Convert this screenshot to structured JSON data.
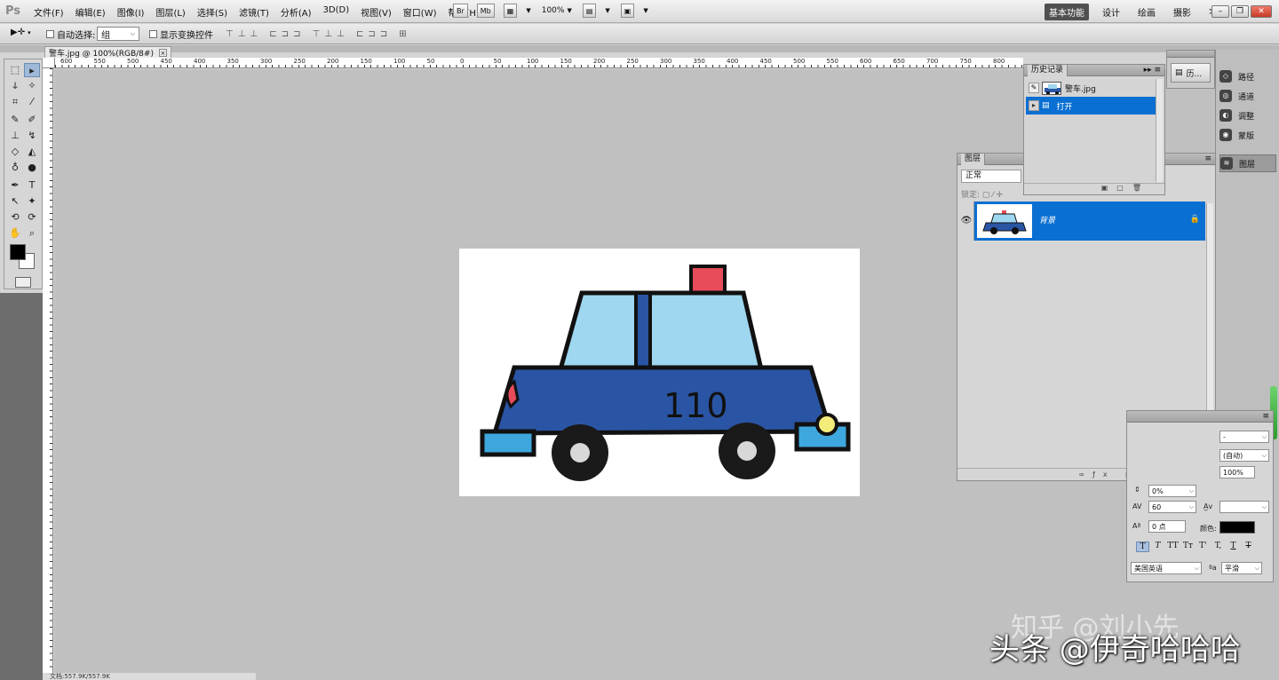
{
  "app": {
    "logo": "Ps"
  },
  "menu": [
    "文件(F)",
    "编辑(E)",
    "图像(I)",
    "图层(L)",
    "选择(S)",
    "滤镜(T)",
    "分析(A)",
    "3D(D)",
    "视图(V)",
    "窗口(W)",
    "帮助(H)"
  ],
  "appbar": {
    "br_label": "Br",
    "mb_label": "Mb",
    "zoom": "100%"
  },
  "workspaces": [
    "基本功能",
    "设计",
    "绘画",
    "摄影"
  ],
  "workspace_more": "≫",
  "options": {
    "auto_select_label": "自动选择:",
    "auto_select_value": "组",
    "show_transform_label": "显示变换控件"
  },
  "ruler_ticks": [
    "600",
    "550",
    "500",
    "450",
    "400",
    "350",
    "300",
    "250",
    "200",
    "150",
    "100",
    "50",
    "0",
    "50",
    "100",
    "150",
    "200",
    "250",
    "300",
    "350",
    "400",
    "450",
    "500",
    "550",
    "600",
    "650",
    "700",
    "750",
    "800"
  ],
  "document": {
    "tab_title": "警车.jpg @ 100%(RGB/8#)",
    "car_number": "110"
  },
  "history_panel": {
    "title": "历史记录",
    "snapshot_name": "警车.jpg",
    "items": [
      {
        "label": "打开"
      }
    ]
  },
  "layers_panel": {
    "title": "图层",
    "blend_mode": "正常",
    "lock_label": "锁定:",
    "layers": [
      {
        "name": "背景"
      }
    ]
  },
  "dock": {
    "collapsed_history": "历...",
    "items": [
      "路径",
      "通道",
      "调整",
      "蒙版",
      "图层"
    ]
  },
  "character_panel": {
    "font_size_dropdown": "-",
    "leading": "(自动)",
    "vertical_scale": "100%",
    "tracking_pct": "0%",
    "kerning": "60",
    "baseline_shift": "0 点",
    "color_label": "颜色:",
    "styles": [
      "T",
      "T",
      "TT",
      "Tт",
      "T'",
      "T,",
      "T",
      "T"
    ],
    "language": "美国英语",
    "aa_label": "ªa",
    "antialias": "平滑"
  },
  "status": {
    "text": "文档:557.9K/557.9K"
  },
  "watermarks": [
    "知乎 @刘小先",
    "头条 @伊奇哈哈哈"
  ],
  "colors": {
    "selection_blue": "#0a6fd2",
    "car_body": "#2a55a4",
    "car_window": "#9ed7ef",
    "siren": "#e84b5a",
    "canvas_bg": "#c0c0c0"
  }
}
